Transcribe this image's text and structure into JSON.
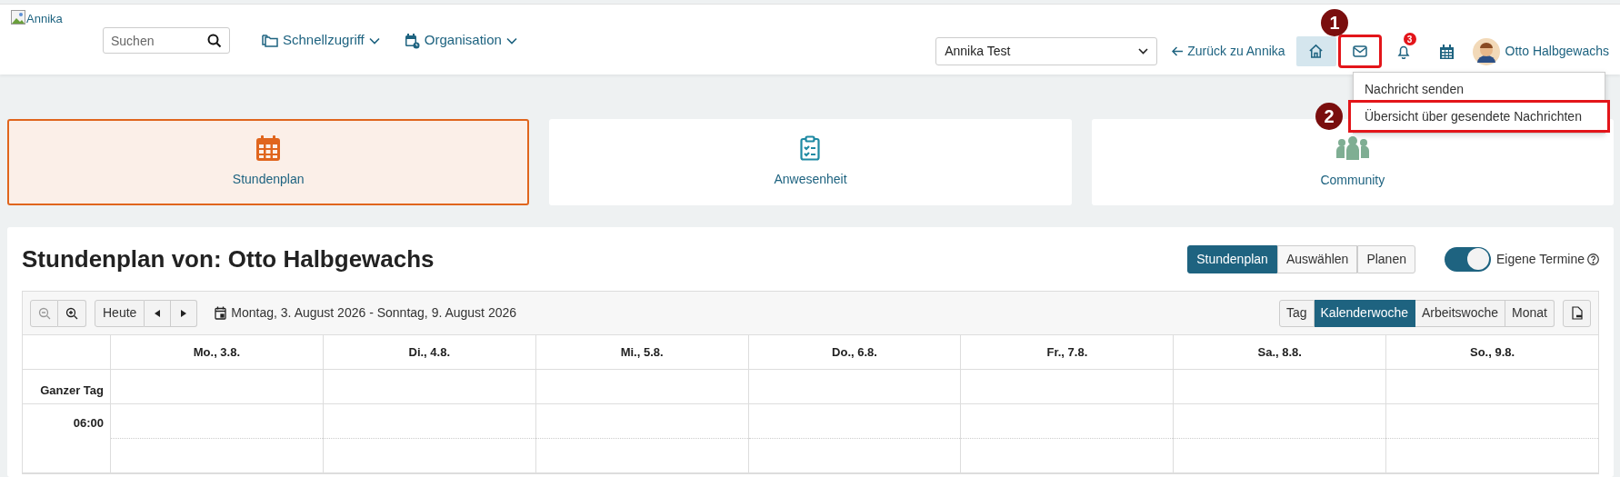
{
  "header": {
    "logo_alt": "Annika",
    "search": {
      "placeholder": "Suchen"
    },
    "nav": [
      {
        "label": "Schnellzugriff",
        "kind": "folder"
      },
      {
        "label": "Organisation",
        "kind": "calendar"
      }
    ],
    "user_select": {
      "value": "Annika Test"
    },
    "back_link": "Zurück zu Annika",
    "icon_buttons": [
      {
        "kind": "home",
        "selected": true,
        "outlined": false
      },
      {
        "kind": "mail",
        "selected": false,
        "outlined": true
      },
      {
        "kind": "bell",
        "selected": false,
        "outlined": false,
        "badge": "3"
      },
      {
        "kind": "calendar",
        "selected": false,
        "outlined": false
      }
    ],
    "user": "Otto Halbgewachs"
  },
  "message_menu": {
    "items": [
      {
        "label": "Nachricht senden",
        "outlined": false
      },
      {
        "label": "Übersicht über gesendete Nachrichten",
        "outlined": true
      }
    ]
  },
  "annotations": [
    {
      "label": "1"
    },
    {
      "label": "2"
    }
  ],
  "tiles": [
    {
      "label": "Stundenplan",
      "kind": "calendar",
      "selected": true
    },
    {
      "label": "Anwesenheit",
      "kind": "clipboard",
      "selected": false
    },
    {
      "label": "Community",
      "kind": "people",
      "selected": false
    }
  ],
  "schedule": {
    "title": "Stundenplan von: Otto Halbgewachs",
    "modes": [
      {
        "label": "Stundenplan",
        "selected": true
      },
      {
        "label": "Auswählen",
        "selected": false
      },
      {
        "label": "Planen",
        "selected": false
      }
    ],
    "own_events": {
      "label": "Eigene Termine",
      "on": true
    },
    "toolbar": {
      "today": "Heute",
      "range": "Montag, 3. August 2026 - Sonntag, 9. August 2026",
      "views": [
        {
          "label": "Tag",
          "selected": false
        },
        {
          "label": "Kalenderwoche",
          "selected": true
        },
        {
          "label": "Arbeitswoche",
          "selected": false
        },
        {
          "label": "Monat",
          "selected": false
        }
      ]
    },
    "columns": [
      "Mo., 3.8.",
      "Di., 4.8.",
      "Mi., 5.8.",
      "Do., 6.8.",
      "Fr., 7.8.",
      "Sa., 8.8.",
      "So., 9.8."
    ],
    "rows": [
      {
        "label": "Ganzer Tag",
        "kind": "allday"
      },
      {
        "label": "06:00",
        "kind": "hour"
      }
    ]
  }
}
